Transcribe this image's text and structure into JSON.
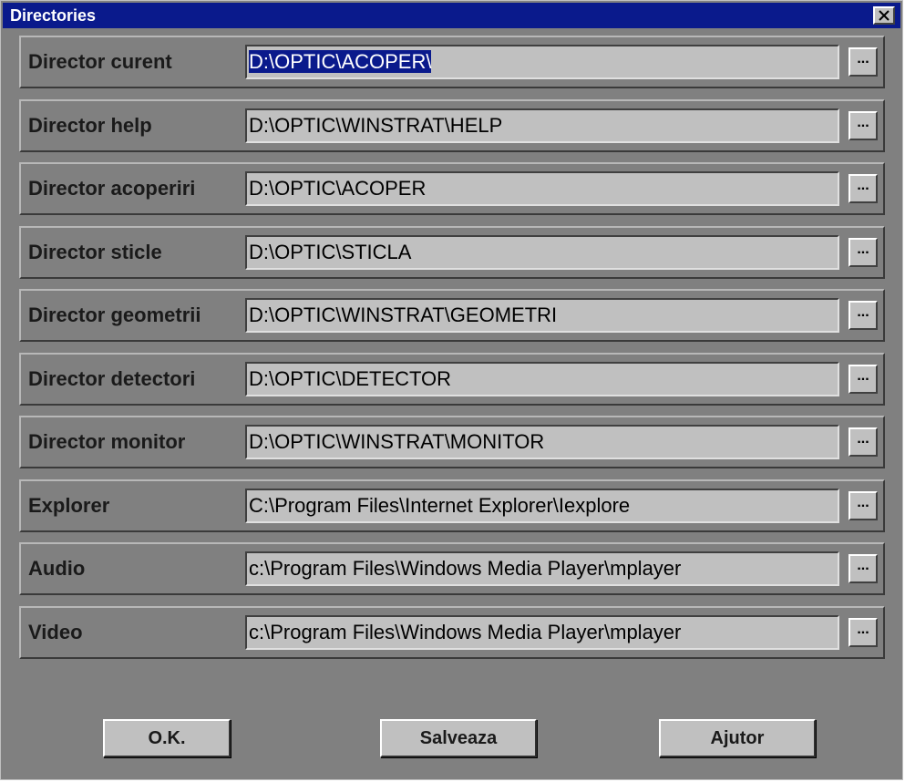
{
  "window": {
    "title": "Directories",
    "close_label": "✕"
  },
  "rows": [
    {
      "label": "Director curent",
      "value": "D:\\OPTIC\\ACOPER\\",
      "selected": true,
      "browse": "..."
    },
    {
      "label": "Director help",
      "value": "D:\\OPTIC\\WINSTRAT\\HELP",
      "browse": "..."
    },
    {
      "label": "Director acoperiri",
      "value": "D:\\OPTIC\\ACOPER",
      "browse": "..."
    },
    {
      "label": "Director sticle",
      "value": "D:\\OPTIC\\STICLA",
      "browse": "..."
    },
    {
      "label": "Director geometrii",
      "value": "D:\\OPTIC\\WINSTRAT\\GEOMETRI",
      "browse": "..."
    },
    {
      "label": "Director detectori",
      "value": "D:\\OPTIC\\DETECTOR",
      "browse": "..."
    },
    {
      "label": "Director monitor",
      "value": "D:\\OPTIC\\WINSTRAT\\MONITOR",
      "browse": "..."
    },
    {
      "label": "Explorer",
      "value": "C:\\Program Files\\Internet Explorer\\Iexplore",
      "browse": "..."
    },
    {
      "label": "Audio",
      "value": "c:\\Program Files\\Windows Media Player\\mplayer",
      "browse": "..."
    },
    {
      "label": "Video",
      "value": "c:\\Program Files\\Windows Media Player\\mplayer",
      "browse": "..."
    }
  ],
  "buttons": {
    "ok": "O.K.",
    "save": "Salveaza",
    "help": "Ajutor"
  },
  "colors": {
    "titlebar": "#0a1a8c",
    "face": "#808080",
    "control": "#c0c0c0"
  }
}
